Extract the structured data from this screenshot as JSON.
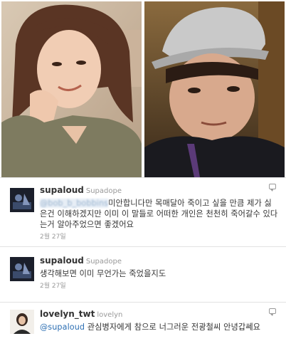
{
  "tweets": [
    {
      "username": "supaloud",
      "fullname": "Supadope",
      "mention": "@bob_b_bobbins",
      "text": "미안합니다만 목매달아 죽이고 싶을 만큼 제가 싫은건 이해하겠지만 이미 이 말들로 어떠한 개인은 천천히 죽어갈수 있다는거 알아주었으면 좋겠어요",
      "date": "2월 27일"
    },
    {
      "username": "supaloud",
      "fullname": "Supadope",
      "text": "생각해보면 이미 무언가는 죽었을지도",
      "date": "2월 27일"
    },
    {
      "username": "lovelyn_twt",
      "fullname": "lovelyn",
      "mention": "@supaloud",
      "text": "관심병자에게 참으로 너그러운 전광철씨 안녕갑쎄요"
    }
  ],
  "colors": {
    "link": "#2d6fb3",
    "username": "#333333",
    "meta": "#999999"
  },
  "icons": [
    "reply-icon",
    "avatar"
  ]
}
